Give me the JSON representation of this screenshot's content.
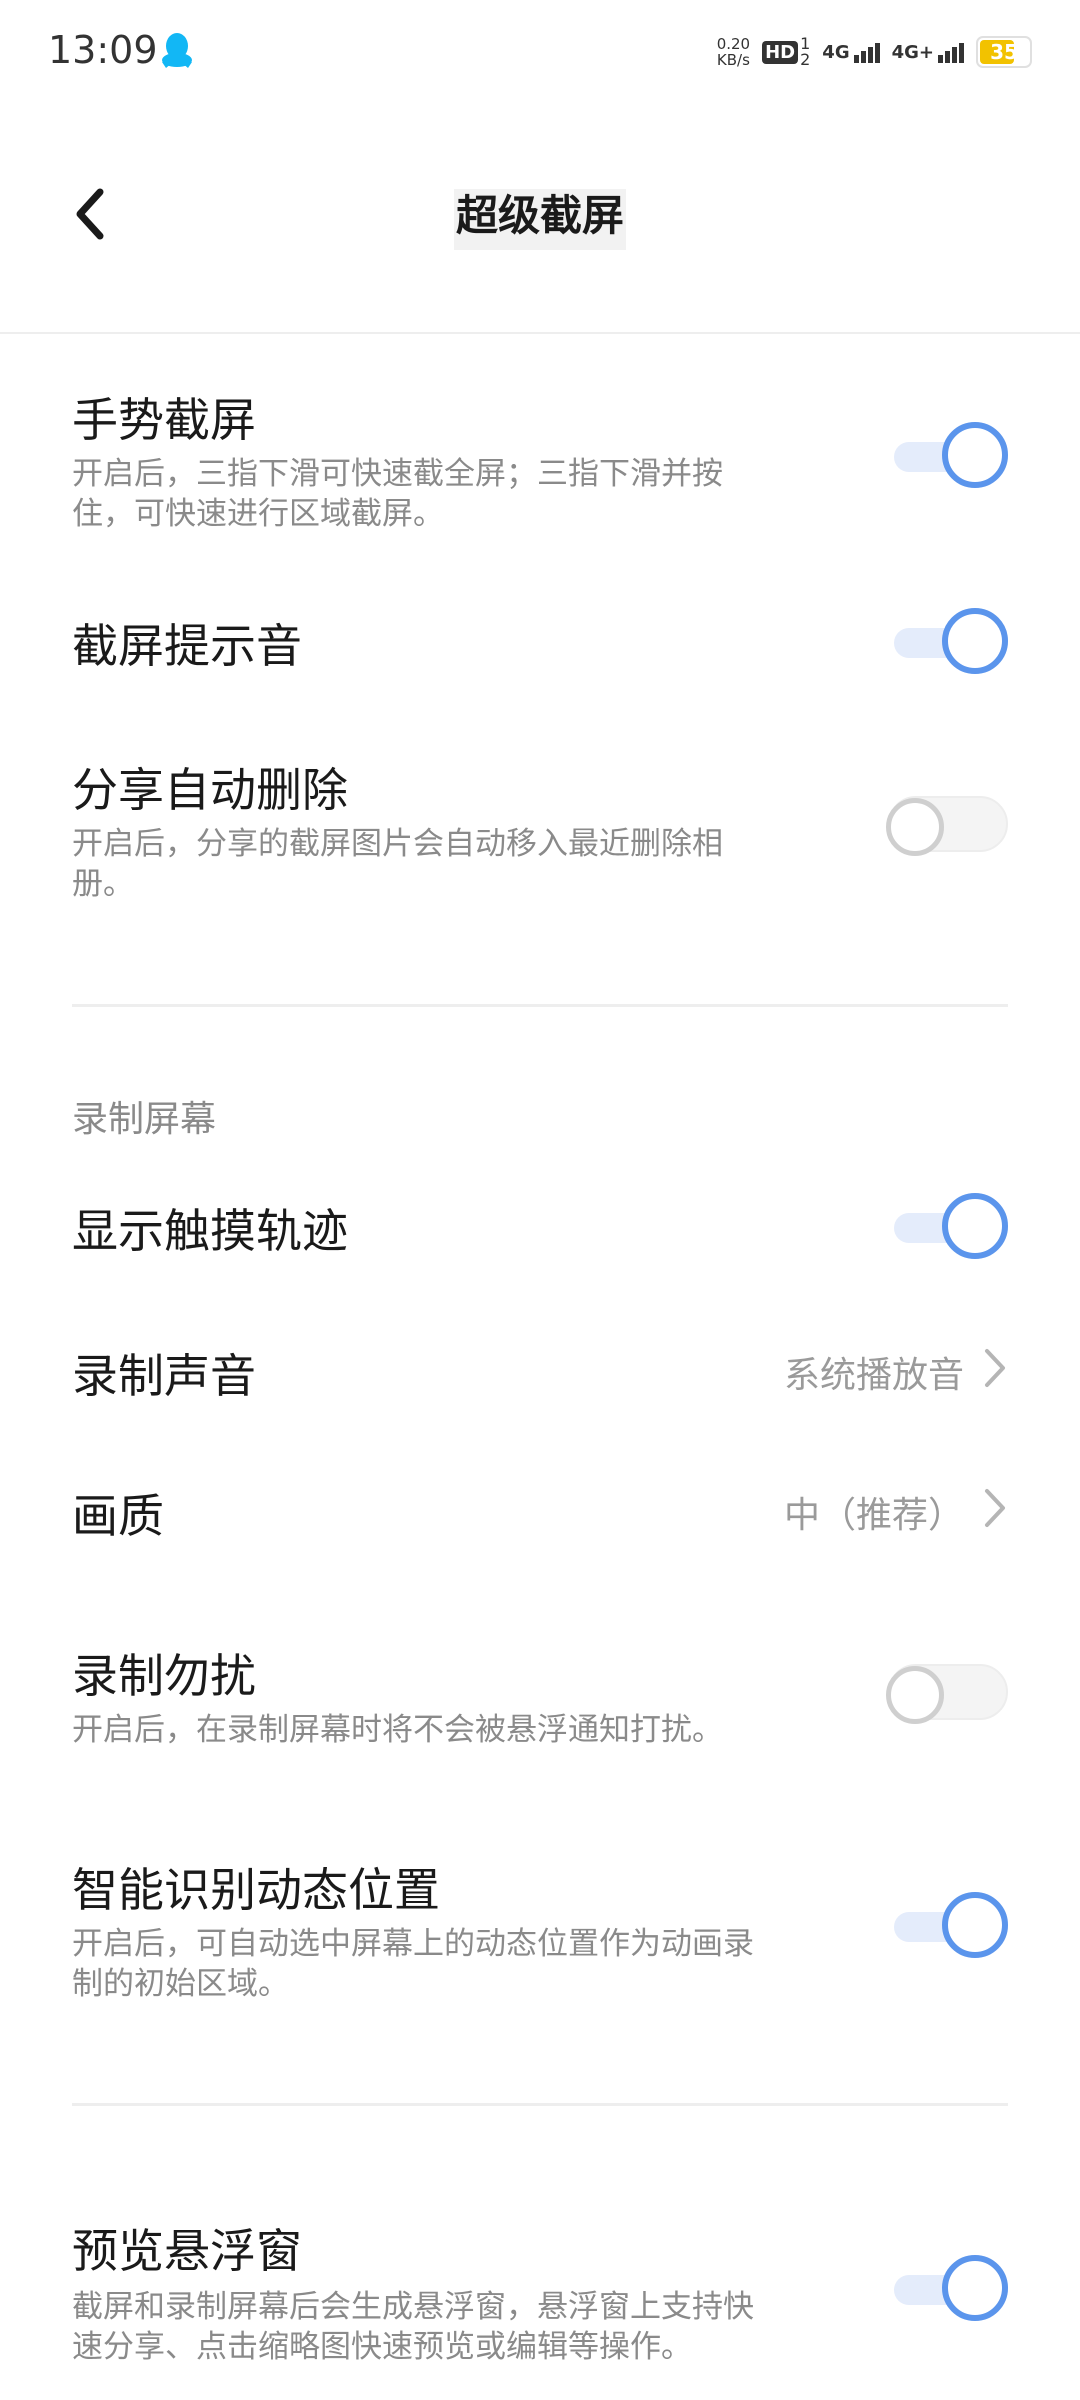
{
  "status_bar": {
    "time": "13:09",
    "speed_value": "0.20",
    "speed_unit": "KB/s",
    "hd": "HD",
    "sim": "1",
    "sim2": "2",
    "net1": "4G",
    "net2": "4G+",
    "battery": "35"
  },
  "header": {
    "title": "超级截屏"
  },
  "items": {
    "gesture": {
      "title": "手势截屏",
      "desc": "开启后，三指下滑可快速截全屏；三指下滑并按住，可快速进行区域截屏。",
      "state": "on"
    },
    "sound": {
      "title": "截屏提示音",
      "state": "on"
    },
    "share_delete": {
      "title": "分享自动删除",
      "desc": "开启后，分享的截屏图片会自动移入最近删除相册。",
      "state": "off"
    },
    "section_record": "录制屏幕",
    "touch_track": {
      "title": "显示触摸轨迹",
      "state": "on"
    },
    "record_sound": {
      "title": "录制声音",
      "value": "系统播放音"
    },
    "quality": {
      "title": "画质",
      "value": "中（推荐）"
    },
    "dnd": {
      "title": "录制勿扰",
      "desc": "开启后，在录制屏幕时将不会被悬浮通知打扰。",
      "state": "off"
    },
    "smart_area": {
      "title": "智能识别动态位置",
      "desc": "开启后，可自动选中屏幕上的动态位置作为动画录制的初始区域。",
      "state": "on"
    },
    "preview": {
      "title": "预览悬浮窗",
      "desc": "截屏和录制屏幕后会生成悬浮窗，悬浮窗上支持快速分享、点击缩略图快速预览或编辑等操作。",
      "state": "on"
    }
  },
  "colors": {
    "accent": "#5b95ec",
    "track_on": "#e4ecfb",
    "muted": "#8a8a8a"
  }
}
